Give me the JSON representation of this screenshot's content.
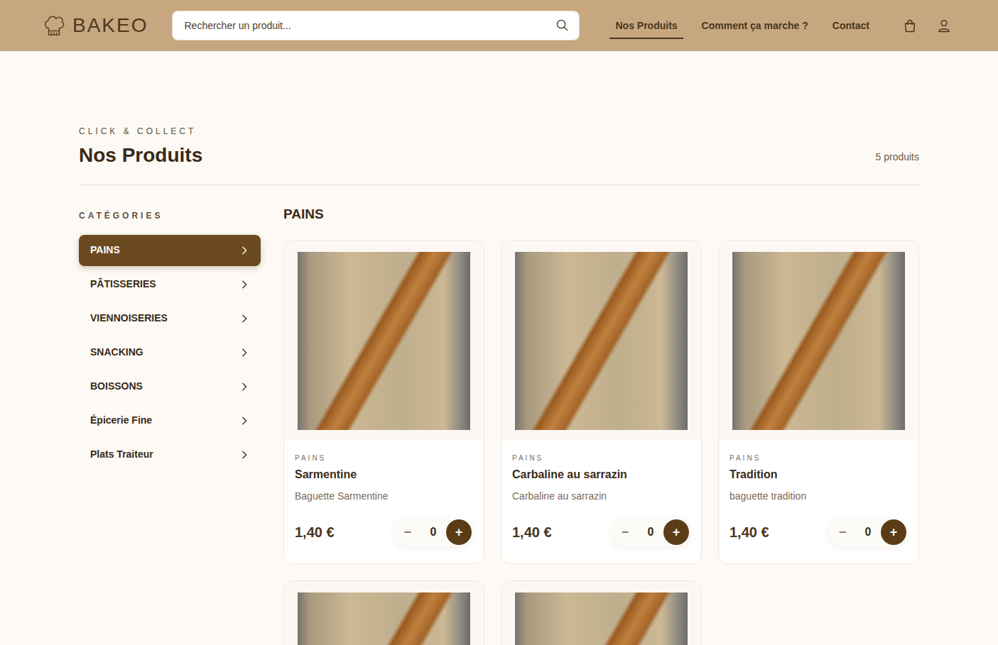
{
  "header": {
    "logo": "BAKEO",
    "search": {
      "placeholder": "Rechercher un produit..."
    },
    "nav": [
      {
        "label": "Nos Produits",
        "selected": true
      },
      {
        "label": "Comment ça marche ?",
        "selected": false
      },
      {
        "label": "Contact",
        "selected": false
      }
    ]
  },
  "page": {
    "eyebrow": "CLICK & COLLECT",
    "title": "Nos Produits",
    "count": "5 produits"
  },
  "sidebar": {
    "title": "CATÉGORIES",
    "items": [
      {
        "label": "PAINS",
        "selected": true
      },
      {
        "label": "PÂTISSERIES",
        "selected": false
      },
      {
        "label": "VIENNOISERIES",
        "selected": false
      },
      {
        "label": "SNACKING",
        "selected": false
      },
      {
        "label": "BOISSONS",
        "selected": false
      },
      {
        "label": "Épicerie Fine",
        "selected": false
      },
      {
        "label": "Plats Traiteur",
        "selected": false
      }
    ]
  },
  "section": {
    "title": "PAINS"
  },
  "products": [
    {
      "kind": "full",
      "category": "PAINS",
      "name": "Sarmentine",
      "description": "Baguette Sarmentine",
      "price": "1,40 €",
      "quantity": "0",
      "minus": "−",
      "plus": "+"
    },
    {
      "kind": "full",
      "category": "PAINS",
      "name": "Carbaline au sarrazin",
      "description": "Carbaline au sarrazin",
      "price": "1,40 €",
      "quantity": "0",
      "minus": "−",
      "plus": "+"
    },
    {
      "kind": "full",
      "category": "PAINS",
      "name": "Tradition",
      "description": "baguette tradition",
      "price": "1,40 €",
      "quantity": "0",
      "minus": "−",
      "plus": "+"
    },
    {
      "kind": "photo"
    },
    {
      "kind": "photo"
    }
  ]
}
